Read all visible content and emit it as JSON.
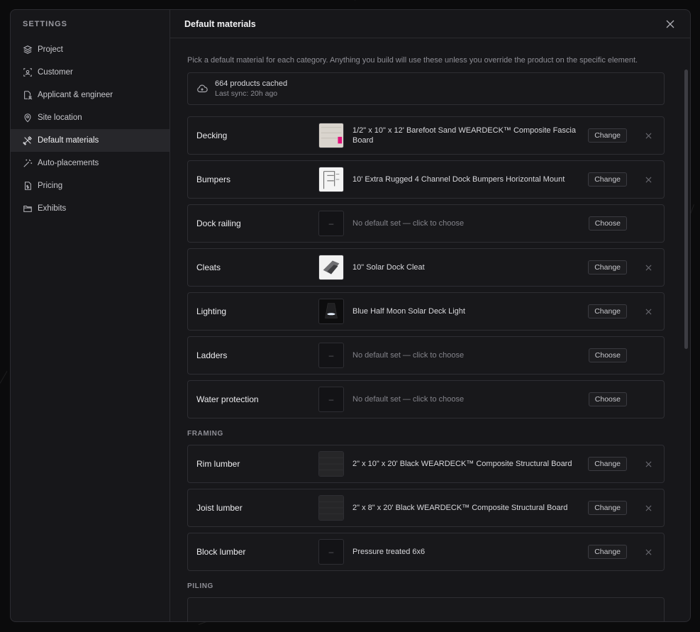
{
  "sidebar": {
    "title": "SETTINGS",
    "items": [
      {
        "label": "Project",
        "icon": "layers-icon"
      },
      {
        "label": "Customer",
        "icon": "person-frame-icon"
      },
      {
        "label": "Applicant & engineer",
        "icon": "document-person-icon"
      },
      {
        "label": "Site location",
        "icon": "map-pin-icon"
      },
      {
        "label": "Default materials",
        "icon": "tools-icon",
        "active": true
      },
      {
        "label": "Auto-placements",
        "icon": "magic-wand-icon"
      },
      {
        "label": "Pricing",
        "icon": "price-document-icon"
      },
      {
        "label": "Exhibits",
        "icon": "folder-icon"
      }
    ]
  },
  "main": {
    "title": "Default materials",
    "intro": "Pick a default material for each category. Anything you build will use these unless you override the product on the specific element.",
    "cache": {
      "count": "664 products cached",
      "sync": "Last sync: 20h ago"
    },
    "rows": [
      {
        "label": "Decking",
        "text": "1/2\" x 10\" x 12' Barefoot Sand WEARDECK™ Composite Fascia Board",
        "action": "Change"
      },
      {
        "label": "Bumpers",
        "text": "10' Extra Rugged 4 Channel Dock Bumpers Horizontal Mount",
        "action": "Change"
      },
      {
        "label": "Dock railing",
        "text": "No default set — click to choose",
        "action": "Choose"
      },
      {
        "label": "Cleats",
        "text": "10\" Solar Dock Cleat",
        "action": "Change"
      },
      {
        "label": "Lighting",
        "text": "Blue Half Moon Solar Deck Light",
        "action": "Change"
      },
      {
        "label": "Ladders",
        "text": "No default set — click to choose",
        "action": "Choose"
      },
      {
        "label": "Water protection",
        "text": "No default set — click to choose",
        "action": "Choose"
      }
    ],
    "framing_title": "FRAMING",
    "framing_rows": [
      {
        "label": "Rim lumber",
        "text": "2\" x 10\" x 20' Black WEARDECK™ Composite Structural Board",
        "action": "Change"
      },
      {
        "label": "Joist lumber",
        "text": "2\" x 8\" x 20' Black WEARDECK™ Composite Structural Board",
        "action": "Change"
      },
      {
        "label": "Block lumber",
        "text": "Pressure treated 6x6",
        "action": "Change"
      }
    ],
    "piling_title": "PILING",
    "empty_thumb": "–"
  }
}
